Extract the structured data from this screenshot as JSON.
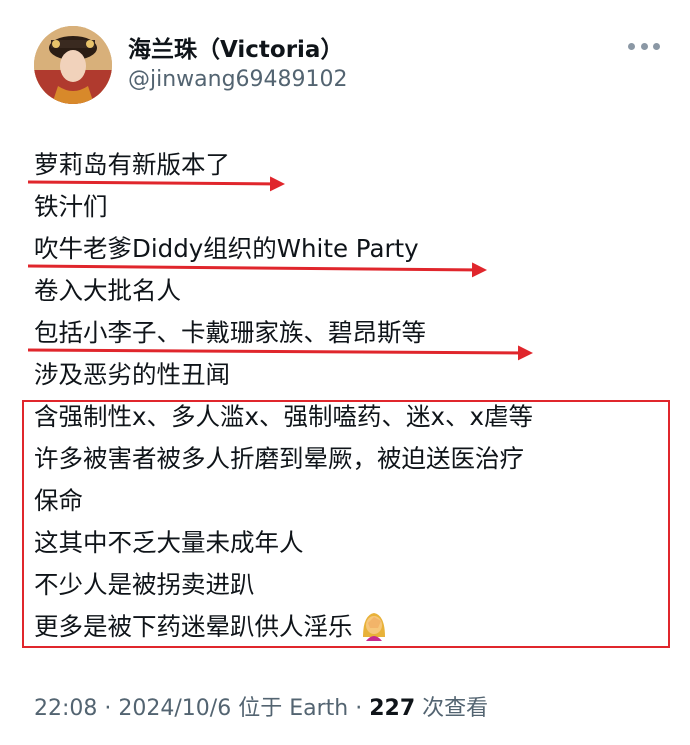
{
  "user": {
    "display_name": "海兰珠（Victoria）",
    "handle": "@jinwang69489102",
    "avatar_icon": "avatar-portrait"
  },
  "tweet": {
    "lines": [
      "萝莉岛有新版本了",
      "铁汁们",
      "吹牛老爹Diddy组织的White Party",
      "卷入大批名人",
      "包括小李子、卡戴珊家族、碧昂斯等",
      "涉及恶劣的性丑闻",
      "含强制性x、多人滥x、强制嗑药、迷x、x虐等",
      "许多被害者被多人折磨到晕厥，被迫送医治疗",
      "保命",
      "这其中不乏大量未成年人",
      "不少人是被拐卖进趴",
      "更多是被下药迷晕趴供人淫乐"
    ],
    "emoji_icon": "facepalm-woman-icon",
    "annotation_color": "#e0262c"
  },
  "meta": {
    "time": "22:08",
    "date": "2024/10/6",
    "location": "位于 Earth",
    "views": "227",
    "views_label": "次查看"
  },
  "more_icon": "more-dots-icon"
}
